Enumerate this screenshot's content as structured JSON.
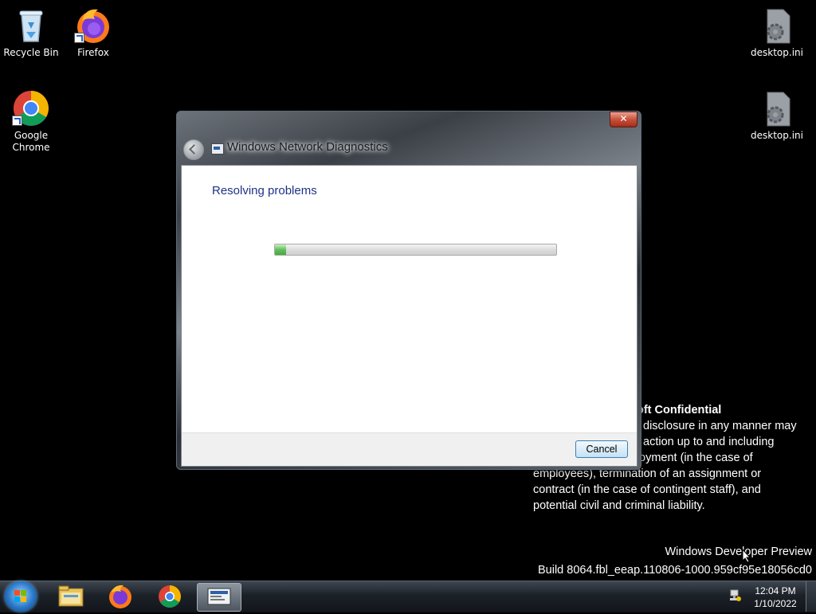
{
  "desktop": {
    "icons": [
      {
        "label": "Recycle Bin",
        "icon": "recycle-bin-icon"
      },
      {
        "label": "Firefox",
        "icon": "firefox-icon"
      },
      {
        "label": "Google Chrome",
        "icon": "chrome-icon"
      },
      {
        "label": "desktop.ini",
        "icon": "settings-file-icon"
      },
      {
        "label": "desktop.ini",
        "icon": "settings-file-icon"
      }
    ],
    "watermark": {
      "title": "oft Confidential",
      "lines": [
        "disclosure in any manner may",
        "action up to and including",
        "oyment (in the case of",
        "employees), termination of an assignment or",
        "contract (in the case of contingent staff), and",
        "potential civil and criminal liability."
      ]
    },
    "build_line1": "Windows Developer Preview",
    "build_line2": "Build 8064.fbl_eeap.110806-1000.959cf95e18056cd0"
  },
  "dialog": {
    "title": "Windows Network Diagnostics",
    "close_label": "✕",
    "heading": "Resolving problems",
    "progress_fraction": 0.04,
    "cancel_label": "Cancel"
  },
  "taskbar": {
    "pinned": [
      "file-explorer-icon",
      "firefox-icon",
      "chrome-icon",
      "network-diagnostics-icon"
    ],
    "clock_time": "12:04 PM",
    "clock_date": "1/10/2022"
  },
  "colors": {
    "heading": "#1e3287",
    "desktop_background": "#000000",
    "progress_fill": "#61c05a"
  }
}
